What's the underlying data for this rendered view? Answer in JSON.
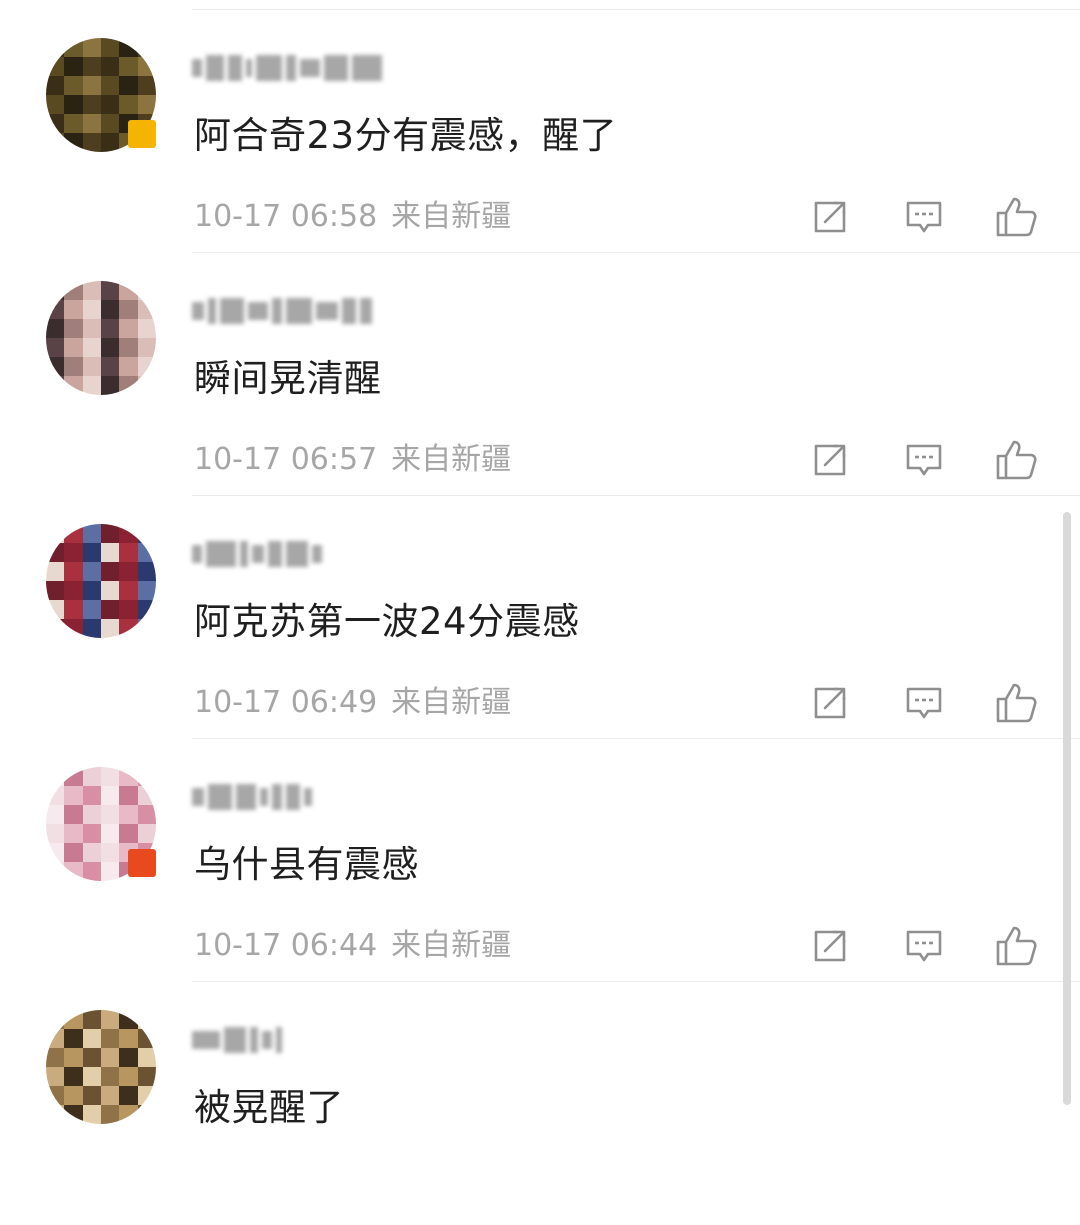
{
  "comments": [
    {
      "text": "阿合奇23分有震感，醒了",
      "time": "10-17 06:58",
      "source": "来自新疆",
      "avatar_colors": [
        "#3b2e17",
        "#6b5a2a",
        "#8c7440",
        "#5a4a22",
        "#2a2314",
        "#4d3f1e"
      ],
      "badge_color": "#f5b400",
      "has_badge": true
    },
    {
      "text": "瞬间晃清醒",
      "time": "10-17 06:57",
      "source": "来自新疆",
      "avatar_colors": [
        "#e8d4cf",
        "#3b2c2e",
        "#a07f7a",
        "#d9bdb6",
        "#5a4347",
        "#c9a59d"
      ],
      "badge_color": "",
      "has_badge": false
    },
    {
      "text": "阿克苏第一波24分震感",
      "time": "10-17 06:49",
      "source": "来自新疆",
      "avatar_colors": [
        "#8a2234",
        "#2b3a6e",
        "#e7d9cf",
        "#a8303f",
        "#5b6fa5",
        "#70202d"
      ],
      "badge_color": "",
      "has_badge": false
    },
    {
      "text": "乌什县有震感",
      "time": "10-17 06:44",
      "source": "来自新疆",
      "avatar_colors": [
        "#f1dfe4",
        "#e8b9c7",
        "#d88ea5",
        "#f7eaee",
        "#c77a91",
        "#ecd0d8"
      ],
      "badge_color": "#e8491d",
      "has_badge": true
    },
    {
      "text": "被晃醒了",
      "time": "",
      "source": "",
      "avatar_colors": [
        "#6b5233",
        "#c9ab7e",
        "#3e2f1d",
        "#e2cfa9",
        "#8f7248",
        "#b8965f"
      ],
      "badge_color": "",
      "has_badge": false
    }
  ],
  "icons": {
    "repost": "repost-icon",
    "reply": "reply-icon",
    "like": "thumbs-up-icon"
  },
  "colors": {
    "meta_text": "#a6a6a6",
    "icon_stroke": "#8f8f8f"
  }
}
